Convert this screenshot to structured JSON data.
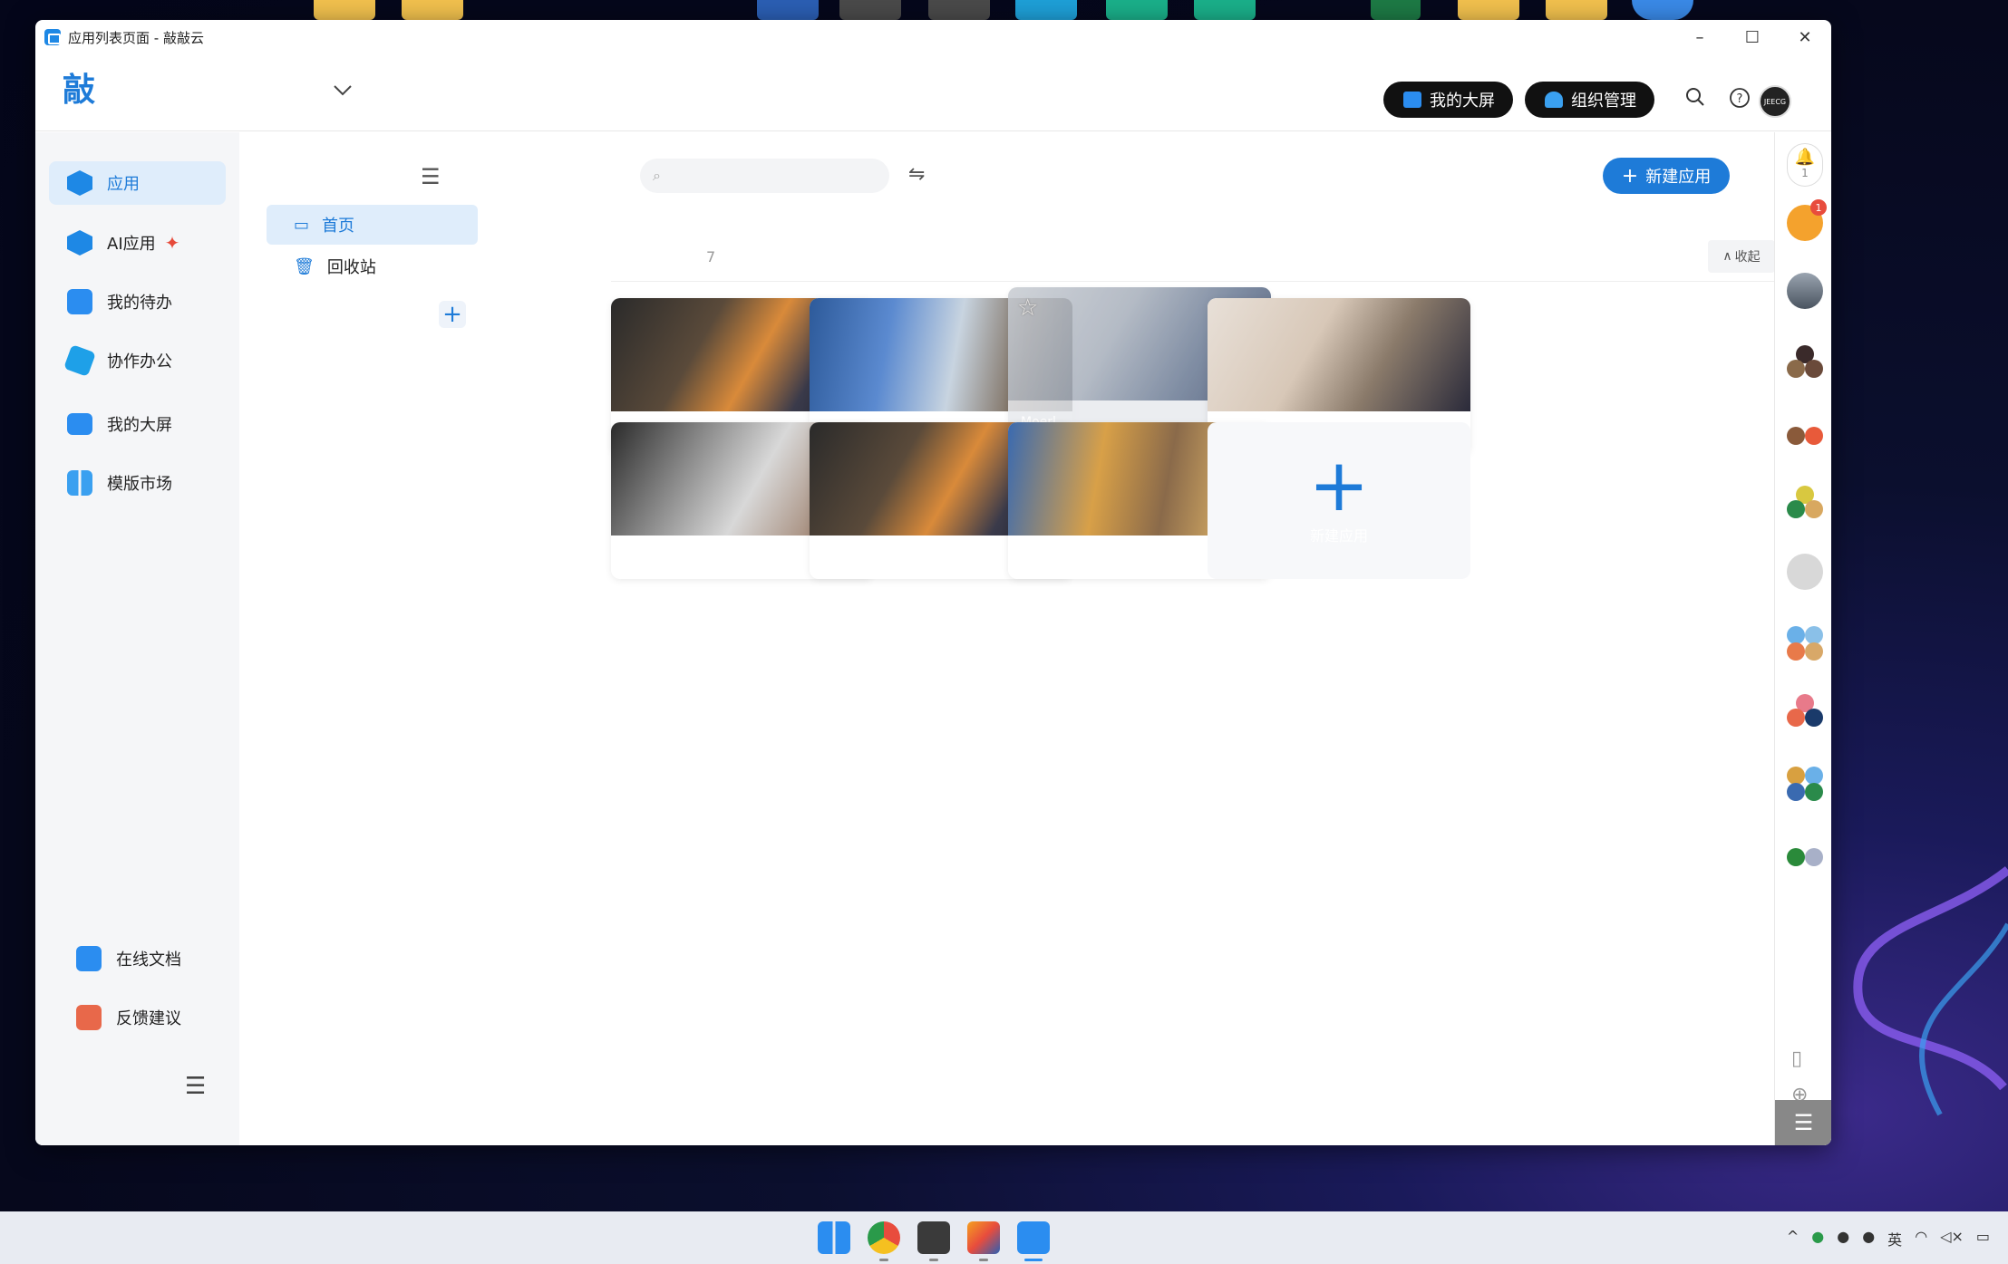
{
  "window": {
    "title": "应用列表页面 - 敲敲云",
    "minimize": "–",
    "maximize": "☐",
    "close": "✕"
  },
  "header": {
    "logo": "敲",
    "dropdown_icon": "chevron-down-icon",
    "big_screen_label": "我的大屏",
    "org_manage_label": "组织管理",
    "avatar_text": "JEECG"
  },
  "sidebar": {
    "items": [
      {
        "label": "应用",
        "icon": "cube-icon",
        "color": "#1e88e5"
      },
      {
        "label": "AI应用",
        "icon": "ai-cube-icon",
        "color": "#1e88e5"
      },
      {
        "label": "我的待办",
        "icon": "clipboard-check-icon",
        "color": "#1e88e5"
      },
      {
        "label": "协作办公",
        "icon": "collab-icon",
        "color": "#1e88e5"
      },
      {
        "label": "我的大屏",
        "icon": "monitor-icon",
        "color": "#1e88e5"
      },
      {
        "label": "模版市场",
        "icon": "grid-icon",
        "color": "#1e88e5"
      }
    ],
    "bottom_items": [
      {
        "label": "在线文档",
        "icon": "document-icon",
        "color": "#2b8df0"
      },
      {
        "label": "反馈建议",
        "icon": "mail-icon",
        "color": "#e8684a"
      }
    ]
  },
  "subnav": {
    "items": [
      {
        "label": "首页",
        "icon": "monitor-icon"
      },
      {
        "label": "回收站",
        "icon": "trash-icon"
      }
    ],
    "add": "+"
  },
  "main": {
    "search_placeholder": "",
    "new_app_label": "新建应用",
    "count": "7",
    "collapse_label": "收起",
    "cards": [
      {
        "name": "",
        "dots_color": "#1e9bd8",
        "img": "linear-gradient(120deg,#2a2a2a 0%,#5a4a3a 35%,#d98a3a 55%,#3a3a4a 75%,#1a2030 100%)"
      },
      {
        "name": "",
        "dots_color": "#444",
        "img": "linear-gradient(100deg,#2d5a9a 0%,#5b8ad0 30%,#c8d4e0 55%,#7a6a5a 80%,#3a3a3a 100%)"
      },
      {
        "name": "Moerl",
        "dots_color": "#1ec8d8",
        "img": "linear-gradient(120deg,#c8ccd2 0%,#a8b0bc 40%,#6a7a94 70%,#3a4a6a 100%)"
      },
      {
        "name": "",
        "dots_color": "#1ec8d8",
        "img": "linear-gradient(120deg,#e8e0d8 0%,#d8c8b8 40%,#8a7a6a 65%,#2a2a3a 100%)"
      },
      {
        "name": "",
        "dots_color": "#e84c3d",
        "img": "linear-gradient(120deg,#2a2a2a 0%,#8a8a8a 30%,#d8d8d8 55%,#a89080 80%,#6a5a4a 100%)"
      },
      {
        "name": "",
        "dots_color": "#1ec8d8",
        "img": "linear-gradient(120deg,#2a2a2a 0%,#5a4a3a 35%,#d98a3a 55%,#3a3a4a 75%,#1a2030 100%)"
      },
      {
        "name": "",
        "dots_color": "#1ec8d8",
        "img": "linear-gradient(100deg,#3a6ab0 0%,#d8a048 35%,#8a6a4a 60%,#c8a060 80%,#4a3a2a 100%)"
      }
    ],
    "new_card_label": "新建应用"
  },
  "rail": {
    "bell_count": "1",
    "grid_badge": "1"
  },
  "taskbar": {
    "tray": [
      "^",
      "英"
    ]
  }
}
